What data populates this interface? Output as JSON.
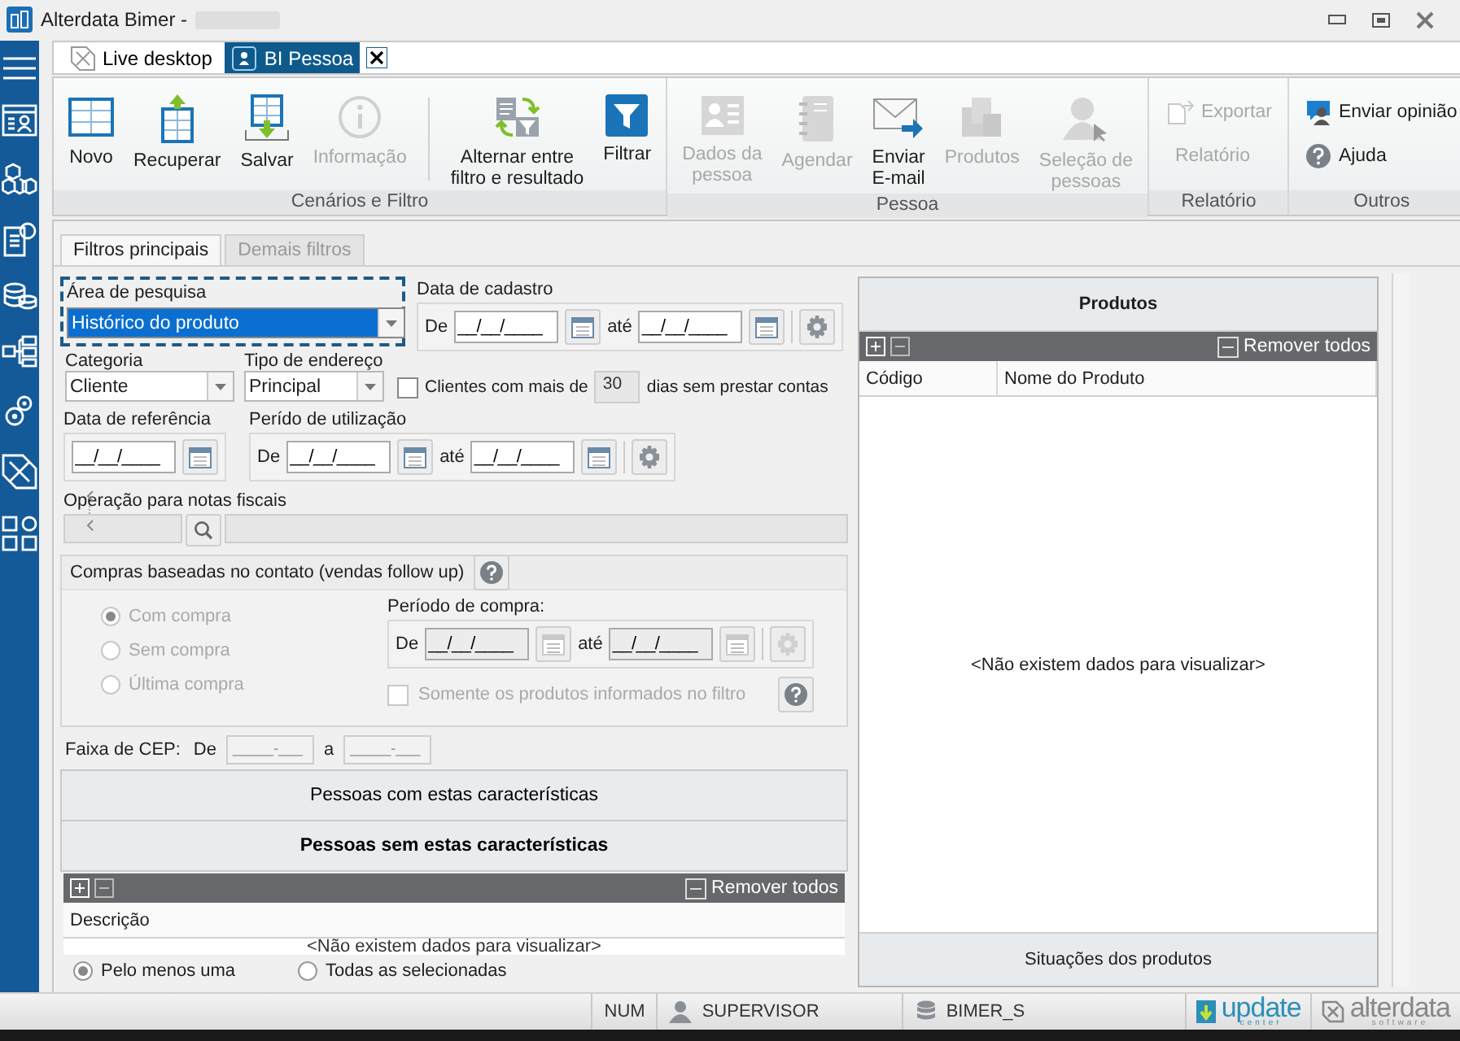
{
  "window": {
    "title": "Alterdata Bimer -"
  },
  "doc_tabs": [
    {
      "label": "Live desktop",
      "selected": false
    },
    {
      "label": "BI Pessoa",
      "selected": true
    }
  ],
  "ribbon": {
    "groups": [
      {
        "label": "Cenários e Filtro",
        "buttons": [
          {
            "kind": "large",
            "label": "Novo",
            "disabled": false
          },
          {
            "kind": "large",
            "label": "Recuperar",
            "disabled": false
          },
          {
            "kind": "large",
            "label": "Salvar",
            "disabled": false
          },
          {
            "kind": "large",
            "label": "Informação",
            "disabled": true
          },
          {
            "kind": "separator"
          },
          {
            "kind": "large",
            "label": "Alternar entre\nfiltro e resultado",
            "disabled": false
          },
          {
            "kind": "large",
            "label": "Filtrar",
            "disabled": false
          }
        ]
      },
      {
        "label": "Pessoa",
        "buttons": [
          {
            "kind": "large",
            "label": "Dados da\npessoa",
            "disabled": true
          },
          {
            "kind": "large",
            "label": "Agendar",
            "disabled": true
          },
          {
            "kind": "large",
            "label": "Enviar\nE-mail",
            "disabled": false
          },
          {
            "kind": "large",
            "label": "Produtos",
            "disabled": true
          },
          {
            "kind": "large",
            "label": "Seleção de\npessoas",
            "disabled": true
          }
        ]
      },
      {
        "label": "Relatório",
        "buttons": [
          {
            "kind": "small",
            "label": "Exportar",
            "disabled": true
          },
          {
            "kind": "small",
            "label": "Relatório",
            "disabled": true
          }
        ]
      },
      {
        "label": "Outros",
        "buttons": [
          {
            "kind": "small",
            "label": "Enviar opinião",
            "disabled": false
          },
          {
            "kind": "small",
            "label": "Ajuda",
            "disabled": false
          }
        ]
      }
    ]
  },
  "filter_tabs": [
    {
      "label": "Filtros principais",
      "selected": true
    },
    {
      "label": "Demais filtros",
      "selected": false
    }
  ],
  "search_area": {
    "label": "Área de pesquisa",
    "value": "Histórico do produto",
    "focused": true
  },
  "registration_date": {
    "label": "Data de cadastro",
    "from_label": "De",
    "from": "__/__/____",
    "to_label": "até",
    "to": "__/__/____"
  },
  "category": {
    "label": "Categoria",
    "value": "Cliente"
  },
  "address_type": {
    "label": "Tipo de endereço",
    "value": "Principal"
  },
  "overdue_clients": {
    "checked": false,
    "label": "Clientes com mais de",
    "days": "30",
    "suffix": "dias sem prestar contas"
  },
  "reference_date": {
    "label": "Data de referência",
    "value": "__/__/____"
  },
  "usage_period": {
    "label": "Perído de utilização",
    "from_label": "De",
    "from": "__/__/____",
    "to_label": "até",
    "to": "__/__/____"
  },
  "invoice_operation": {
    "label": "Operação para notas fiscais"
  },
  "follow_up": {
    "title": "Compras baseadas no contato (vendas follow up)",
    "disabled": true,
    "options": [
      {
        "label": "Com compra",
        "selected": true
      },
      {
        "label": "Sem compra",
        "selected": false
      },
      {
        "label": "Última compra",
        "selected": false
      }
    ],
    "period": {
      "label": "Período de compra:",
      "from_label": "De",
      "from": "__/__/____",
      "to_label": "até",
      "to": "__/__/____"
    },
    "only_filtered": {
      "label": "Somente os produtos informados no filtro",
      "checked": false
    }
  },
  "cep_range": {
    "label": "Faixa de CEP:",
    "from_label": "De",
    "from": "_____-___",
    "to_label": "a",
    "to": "_____-___"
  },
  "sections": [
    {
      "label": "Pessoas com estas características",
      "selected": false
    },
    {
      "label": "Pessoas sem estas características",
      "selected": true
    }
  ],
  "characteristics_grid": {
    "remove_all": "Remover todos",
    "columns": [
      "Descrição"
    ],
    "empty": "<Não existem dados para visualizar>"
  },
  "match_mode": [
    {
      "label": "Pelo menos uma",
      "selected": true
    },
    {
      "label": "Todas as selecionadas",
      "selected": false
    }
  ],
  "products": {
    "title": "Produtos",
    "remove_all": "Remover todos",
    "columns": [
      "Código",
      "Nome do Produto"
    ],
    "empty": "<Não existem dados para visualizar>",
    "footer": "Situações dos produtos"
  },
  "status_bar": {
    "num": "NUM",
    "user": "SUPERVISOR",
    "database": "BIMER_S",
    "update_logo": "update",
    "update_sub": "center",
    "brand_logo": "alterdata",
    "brand_sub": "software"
  }
}
